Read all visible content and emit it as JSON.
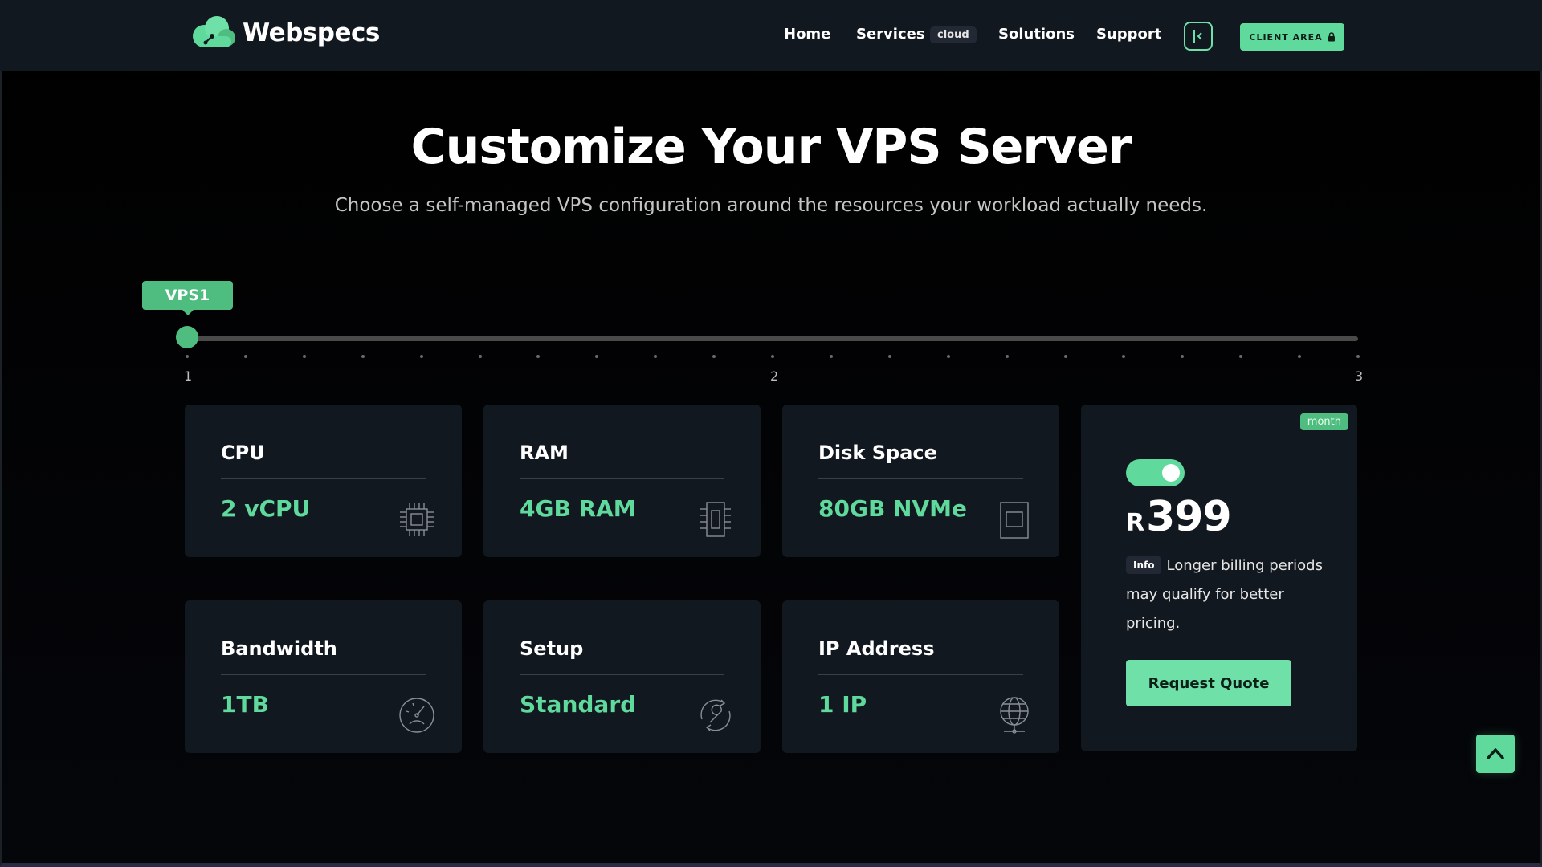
{
  "header": {
    "brand": "Webspecs",
    "nav": {
      "home": "Home",
      "services": "Services",
      "services_badge": "cloud",
      "solutions": "Solutions",
      "support": "Support"
    },
    "client_area": "CLIENT AREA"
  },
  "hero": {
    "title": "Customize Your VPS Server",
    "subtitle": "Choose a self-managed VPS configuration around the resources your workload actually needs."
  },
  "slider": {
    "selected_label": "VPS1",
    "selected_value": 1,
    "min": 1,
    "max": 3,
    "tick_labels": [
      "1",
      "2",
      "3"
    ],
    "tick_count": 21
  },
  "specs": [
    {
      "title": "CPU",
      "value": "2 vCPU",
      "icon": "cpu-icon"
    },
    {
      "title": "RAM",
      "value": "4GB RAM",
      "icon": "memory-icon"
    },
    {
      "title": "Disk Space",
      "value": "80GB NVMe",
      "icon": "disk-icon"
    },
    {
      "title": "Bandwidth",
      "value": "1TB",
      "icon": "gauge-icon"
    },
    {
      "title": "Setup",
      "value": "Standard",
      "icon": "wrench-icon"
    },
    {
      "title": "IP Address",
      "value": "1 IP",
      "icon": "globe-icon"
    }
  ],
  "pricing": {
    "period_badge": "month",
    "toggle_on": true,
    "currency": "R",
    "amount": "399",
    "info_badge": "Info",
    "info_text": "Longer billing periods may qualify for better pricing.",
    "cta": "Request Quote"
  },
  "colors": {
    "accent": "#5fd99c",
    "accent_dark": "#4fbd80",
    "card_bg": "#121820",
    "page_bg": "#000000"
  }
}
